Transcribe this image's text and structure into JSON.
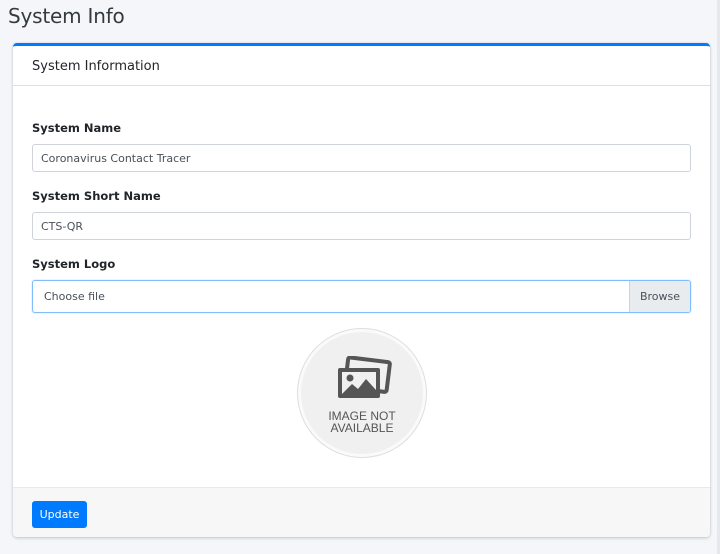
{
  "page": {
    "title": "System Info"
  },
  "card": {
    "title": "System Information",
    "fields": {
      "system_name": {
        "label": "System Name",
        "value": "Coronavirus Contact Tracer"
      },
      "short_name": {
        "label": "System Short Name",
        "value": "CTS-QR"
      },
      "logo": {
        "label": "System Logo",
        "file_placeholder": "Choose file",
        "browse_label": "Browse"
      }
    },
    "logo_preview": {
      "line1": "IMAGE NOT",
      "line2": "AVAILABLE",
      "icon": "image-placeholder-icon"
    },
    "footer": {
      "update_label": "Update"
    }
  },
  "colors": {
    "accent": "#007bff",
    "background": "#f4f6f9",
    "footer_bg": "#f7f7f7"
  }
}
